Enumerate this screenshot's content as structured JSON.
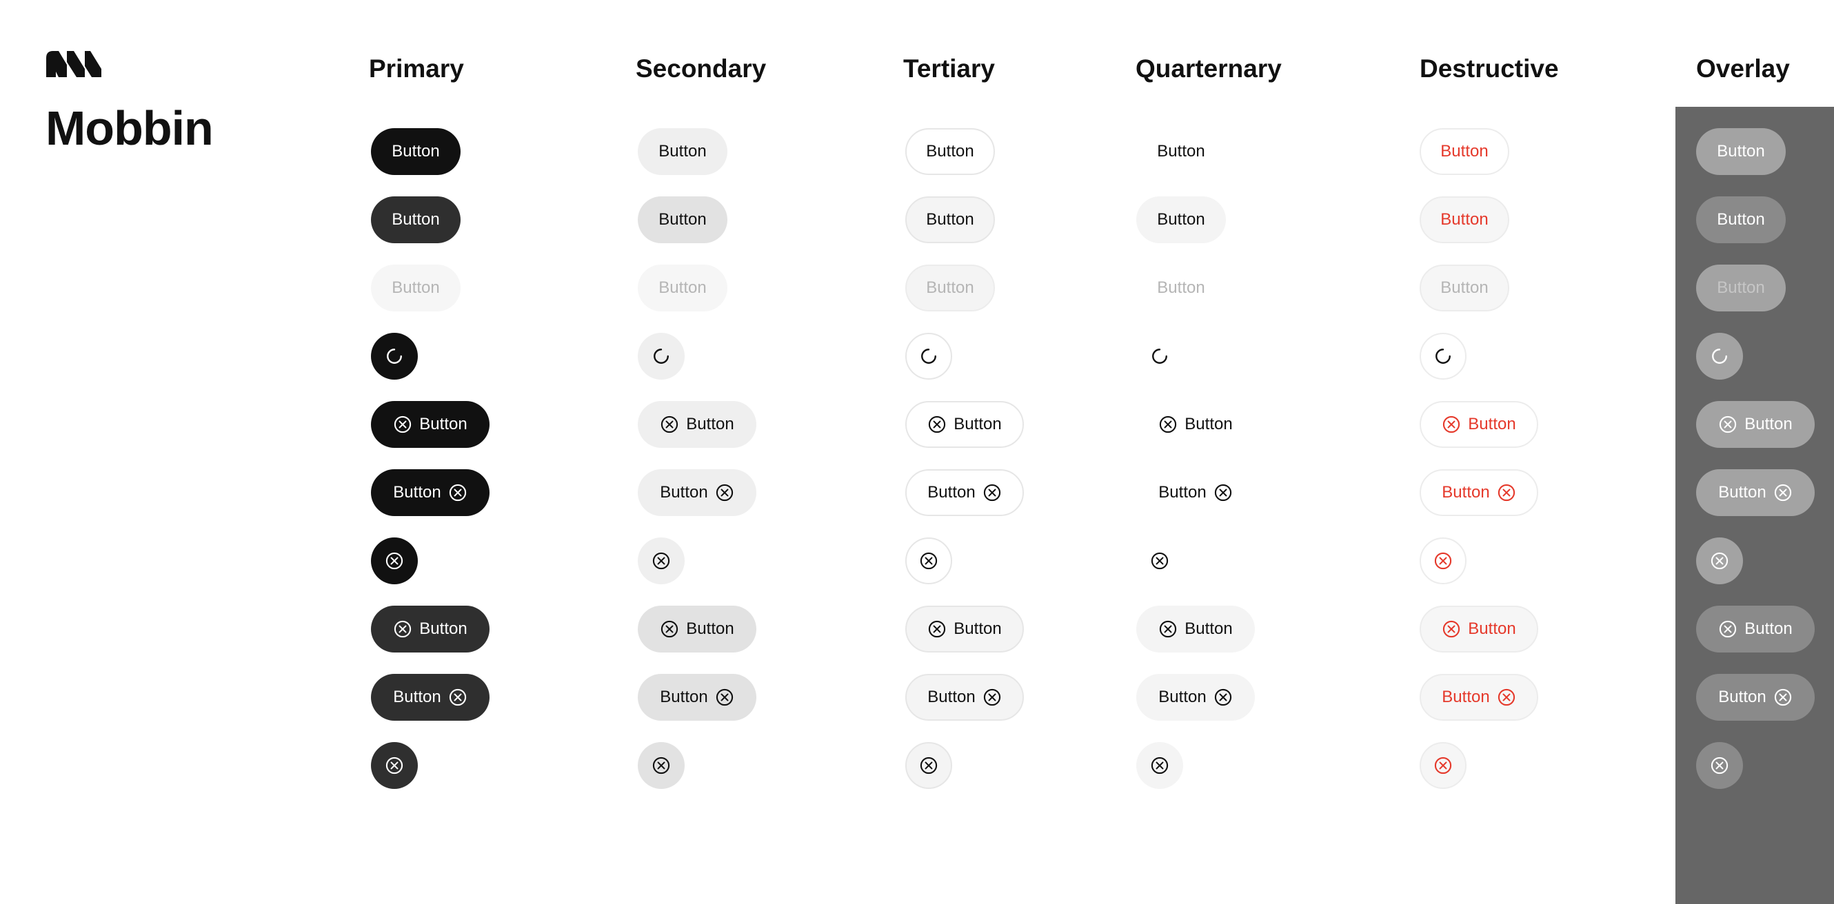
{
  "brand": {
    "name": "Mobbin",
    "logo_icon": "mobbin-logo-icon"
  },
  "columns": [
    {
      "key": "primary",
      "label": "Primary"
    },
    {
      "key": "secondary",
      "label": "Secondary"
    },
    {
      "key": "tertiary",
      "label": "Tertiary"
    },
    {
      "key": "quarternary",
      "label": "Quarternary"
    },
    {
      "key": "destructive",
      "label": "Destructive"
    },
    {
      "key": "overlay",
      "label": "Overlay"
    }
  ],
  "rows": [
    {
      "state": "default",
      "variant": "text"
    },
    {
      "state": "pressed",
      "variant": "text"
    },
    {
      "state": "disabled",
      "variant": "text"
    },
    {
      "state": "loading",
      "variant": "spinner"
    },
    {
      "state": "default",
      "variant": "leading-icon"
    },
    {
      "state": "default",
      "variant": "trailing-icon"
    },
    {
      "state": "default",
      "variant": "icon-only"
    },
    {
      "state": "pressed",
      "variant": "leading-icon"
    },
    {
      "state": "pressed",
      "variant": "trailing-icon"
    },
    {
      "state": "pressed",
      "variant": "icon-only"
    }
  ],
  "button_label": "Button",
  "icons": {
    "button": "circle-x-icon",
    "loading": "spinner-icon"
  },
  "colors": {
    "primary": "#111111",
    "primary_pressed": "#2f2f2f",
    "secondary": "#efefef",
    "destructive_text": "#e5392b",
    "overlay_panel": "#666666",
    "overlay_button": "#a3a3a3"
  }
}
